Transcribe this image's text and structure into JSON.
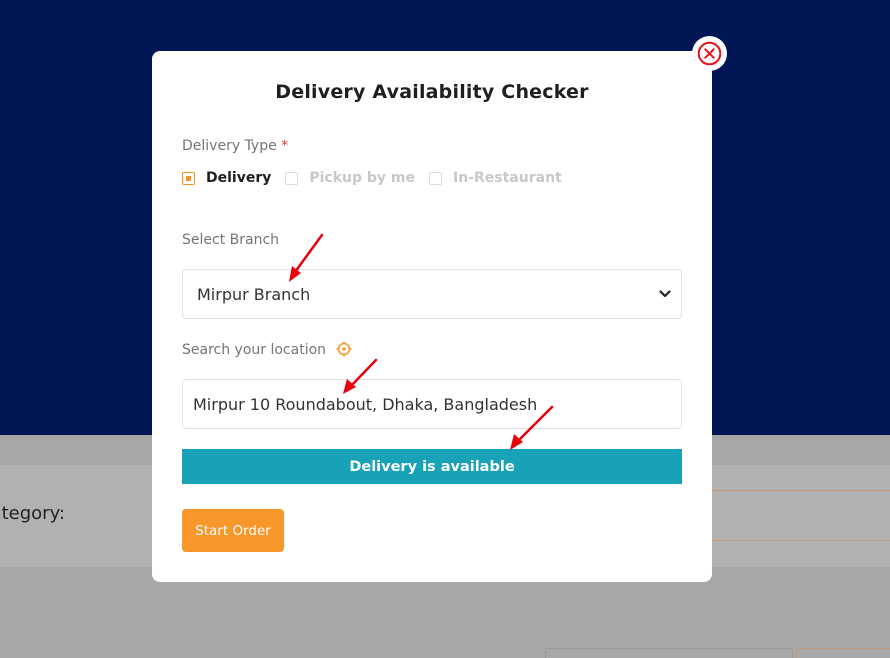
{
  "background": {
    "category_label": "Category:",
    "hero_color": "#001655"
  },
  "modal": {
    "title": "Delivery Availability Checker",
    "close_icon": "close-circle-icon",
    "delivery_type": {
      "label": "Delivery Type",
      "required_mark": "*",
      "options": [
        {
          "label": "Delivery",
          "checked": true
        },
        {
          "label": "Pickup by me",
          "checked": false
        },
        {
          "label": "In-Restaurant",
          "checked": false
        }
      ]
    },
    "branch": {
      "label": "Select Branch",
      "selected": "Mirpur Branch"
    },
    "location": {
      "label": "Search your location",
      "icon": "crosshair-target-icon",
      "value": "Mirpur 10 Roundabout, Dhaka, Bangladesh"
    },
    "status": {
      "text": "Delivery is available",
      "color": "#17a2b8"
    },
    "start_button": {
      "label": "Start Order",
      "color": "#f7972a"
    }
  },
  "annotations": {
    "arrow_color": "#e8000b",
    "arrow_count": 3
  }
}
